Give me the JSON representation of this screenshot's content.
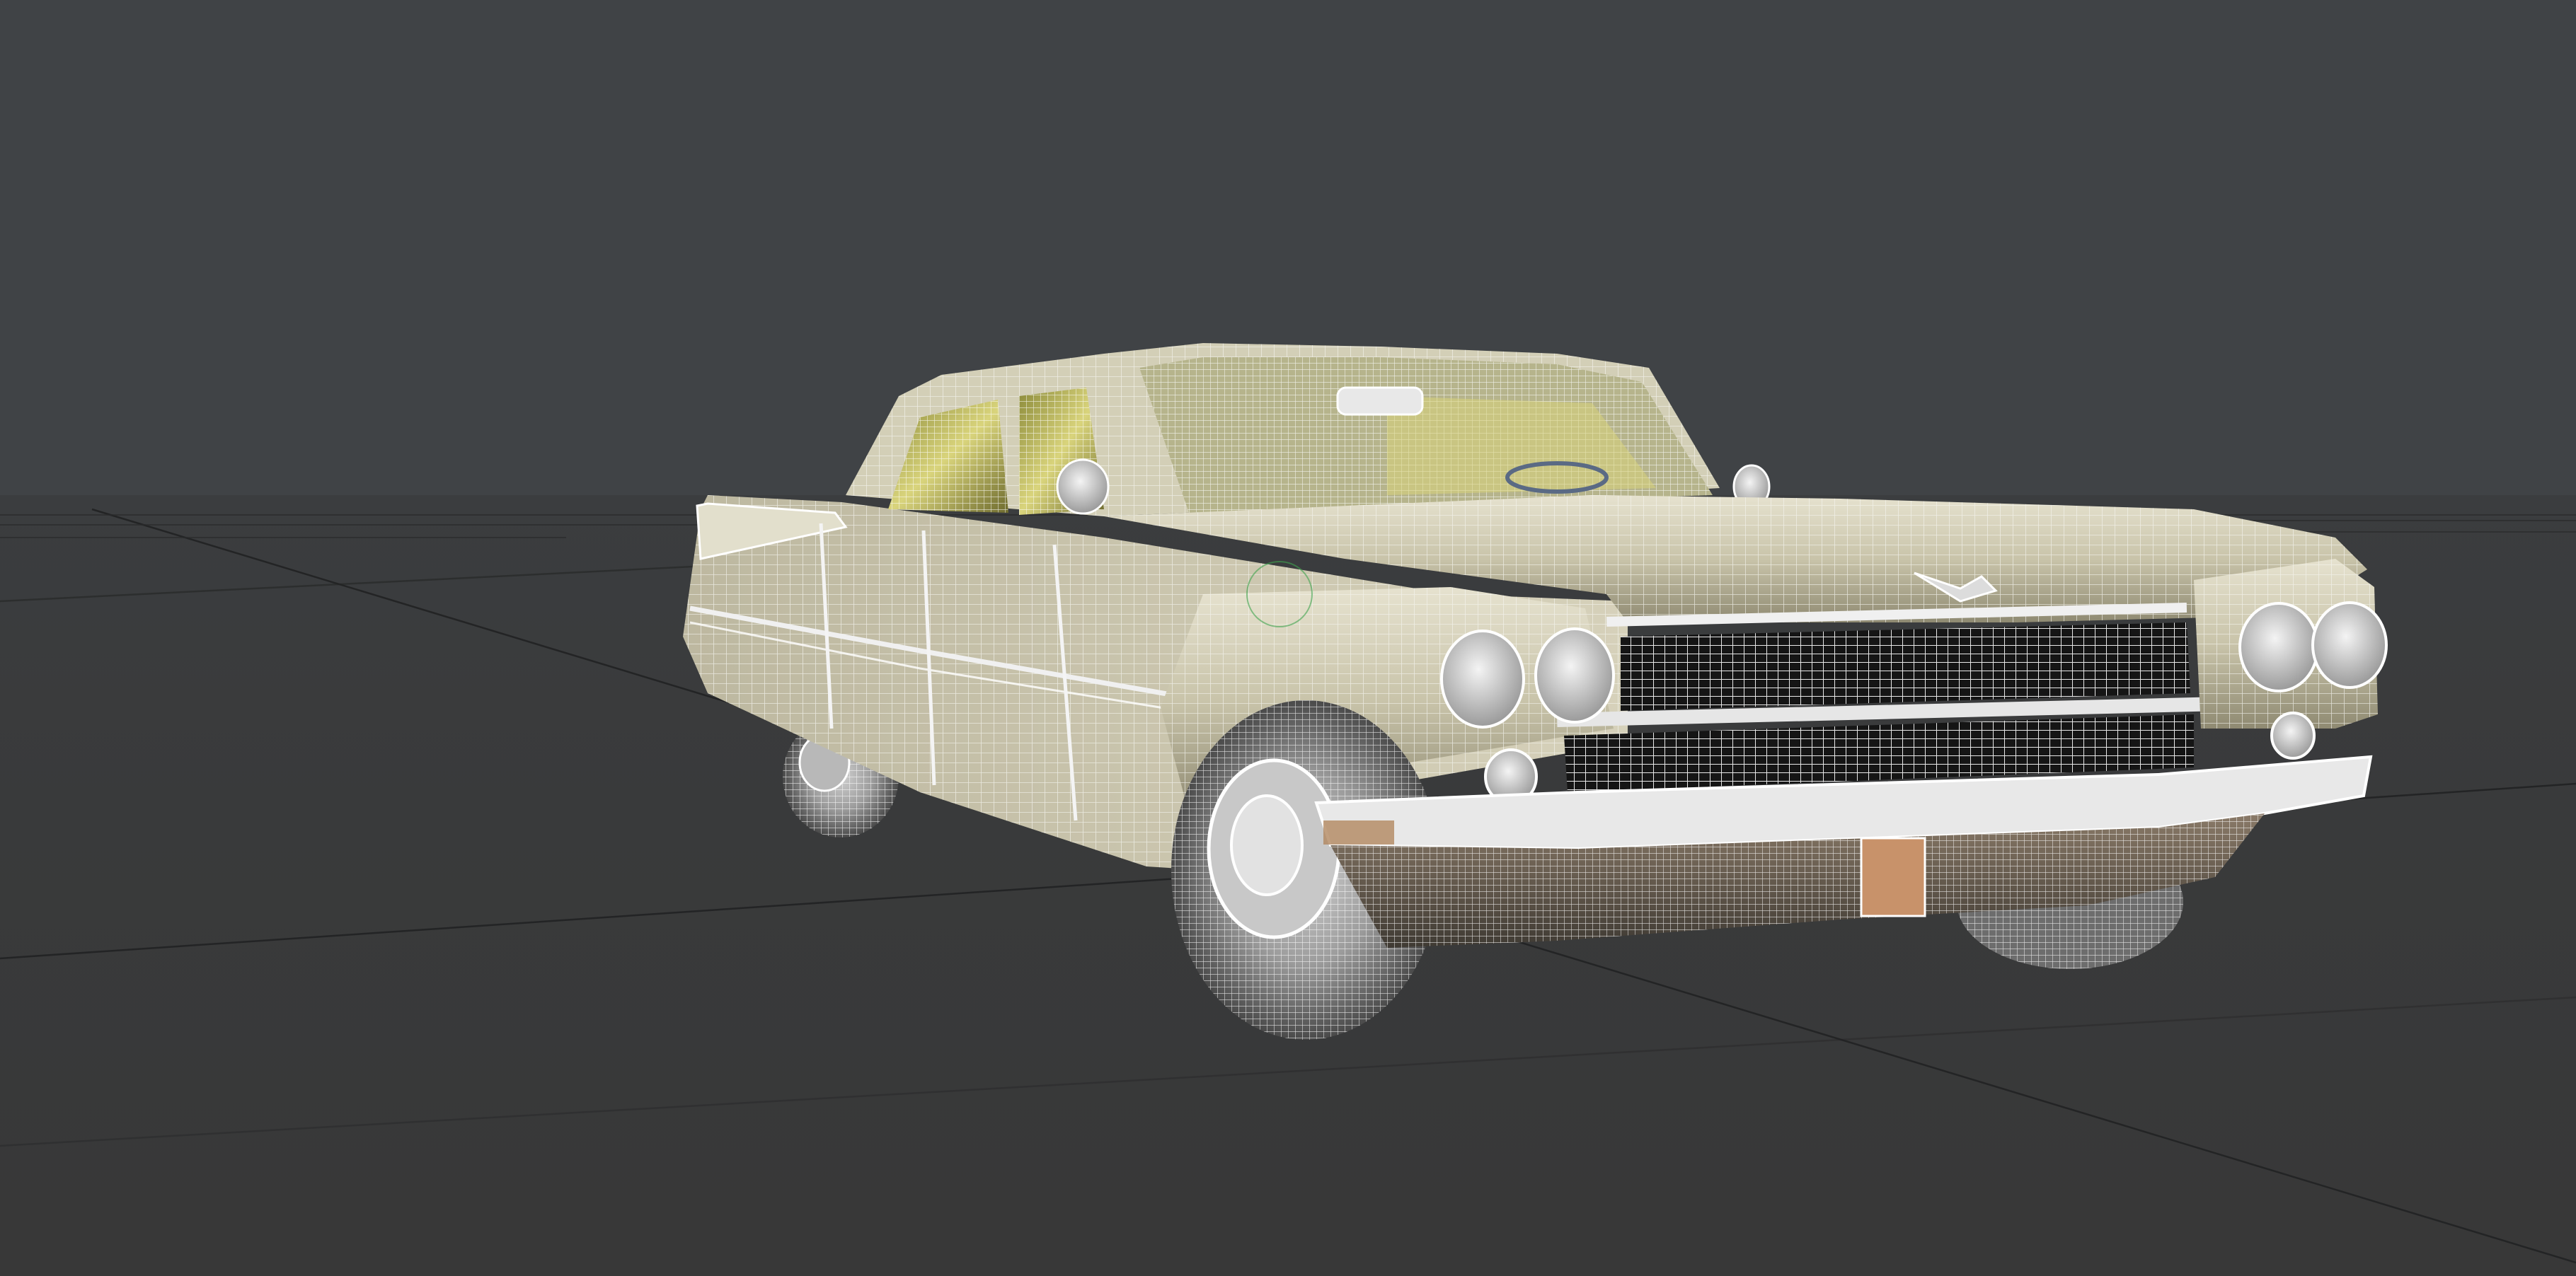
{
  "viewport": {
    "mode": "wireframe-on-shaded",
    "object": "vintage-sedan-car",
    "colors": {
      "background": "#404346",
      "ground_plane": "#393a3b",
      "grid_line": "#262728",
      "body_paint": "#d9d5bf",
      "wire": "#f2f2f2",
      "glass_tint": "#d8d37a",
      "chrome": "#c8c8c8",
      "turn_signal": "#c8926a"
    }
  }
}
